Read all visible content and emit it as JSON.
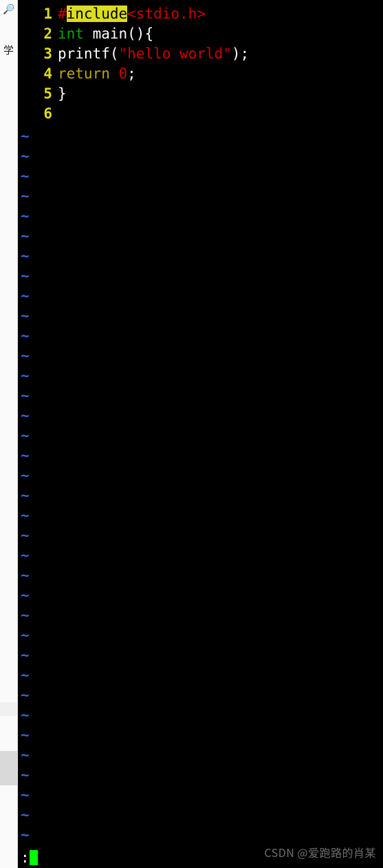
{
  "left": {
    "search_glyph": "🔍",
    "char": "学"
  },
  "editor": {
    "linenos": [
      "1",
      "2",
      "3",
      "4",
      "5",
      "6"
    ],
    "code": {
      "l1": {
        "hash": "#",
        "include": "include",
        "header": "<stdio.h>"
      },
      "l2": {
        "int": "int",
        "main": " main(){"
      },
      "l3": {
        "printf": "printf(",
        "str": "\"hello world\"",
        "end": ");"
      },
      "l4": {
        "ret": "return ",
        "zero": "0",
        "semi": ";"
      },
      "l5": {
        "brace": "}"
      }
    },
    "tilde": "~",
    "status_prefix": ":"
  },
  "watermark": "CSDN @爱跑路的肖某"
}
